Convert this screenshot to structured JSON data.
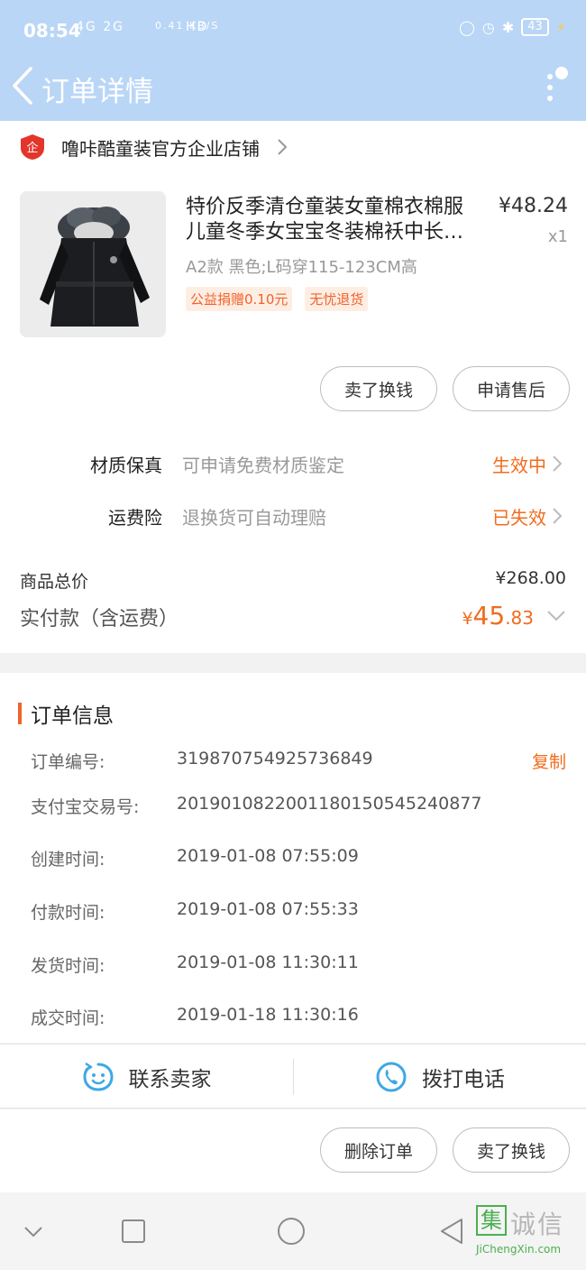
{
  "status_bar": {
    "time": "08:54",
    "signal": "4G 2G",
    "speed": "0.41 KB/S",
    "hd": "HD",
    "battery": "43"
  },
  "header": {
    "title": "订单详情"
  },
  "shop": {
    "badge": "企",
    "name": "噜咔酷童装官方企业店铺"
  },
  "product": {
    "title": "特价反季清仓童装女童棉衣棉服儿童冬季女宝宝冬装棉袄中长…",
    "price": "¥48.24",
    "qty": "x1",
    "sku": "A2款 黑色;L码穿115-123CM高",
    "tags": [
      "公益捐赠0.10元",
      "无忧退货"
    ]
  },
  "item_actions": {
    "sell_label": "卖了换钱",
    "after_sale_label": "申请售后"
  },
  "services": [
    {
      "label": "材质保真",
      "desc": "可申请免费材质鉴定",
      "status": "生效中"
    },
    {
      "label": "运费险",
      "desc": "退换货可自动理赔",
      "status": "已失效"
    }
  ],
  "totals": {
    "goods_label": "商品总价",
    "goods_value": "¥268.00",
    "paid_label": "实付款（含运费）",
    "paid_currency": "¥",
    "paid_int": "45",
    "paid_dec": ".83"
  },
  "order_info": {
    "heading": "订单信息",
    "copy_label": "复制",
    "rows": [
      {
        "key": "订单编号:",
        "value": "319870754925736849"
      },
      {
        "key": "支付宝交易号:",
        "value": "2019010822001180150545240877"
      },
      {
        "key": "创建时间:",
        "value": "2019-01-08 07:55:09"
      },
      {
        "key": "付款时间:",
        "value": "2019-01-08 07:55:33"
      },
      {
        "key": "发货时间:",
        "value": "2019-01-08 11:30:11"
      },
      {
        "key": "成交时间:",
        "value": "2019-01-18 11:30:16"
      }
    ]
  },
  "contact": {
    "seller_label": "联系卖家",
    "phone_label": "拨打电话"
  },
  "bottom_actions": {
    "delete_label": "删除订单",
    "sell_label": "卖了换钱"
  },
  "watermark": {
    "logo": "集",
    "text": "诚信",
    "sub": "JiChengXin.com"
  },
  "colors": {
    "header_bg": "#b9d6f6",
    "accent": "#f26b1d",
    "tag_bg": "#fdeee4",
    "icon_blue": "#3ea7e6"
  }
}
